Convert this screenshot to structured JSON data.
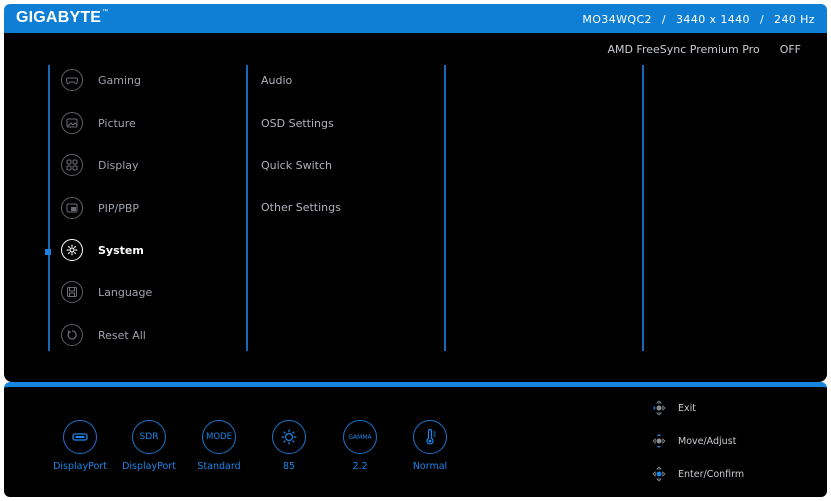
{
  "header": {
    "brand": "GIGABYTE",
    "trademark": "™",
    "model": "MO34WQC2",
    "separator": "/",
    "resolution": "3440 x 1440",
    "refresh_rate": "240 Hz"
  },
  "status": {
    "label": "AMD FreeSync Premium Pro",
    "value": "OFF"
  },
  "menu": {
    "items": [
      {
        "label": "Gaming",
        "icon": "gamepad-icon"
      },
      {
        "label": "Picture",
        "icon": "picture-icon"
      },
      {
        "label": "Display",
        "icon": "display-icon"
      },
      {
        "label": "PIP/PBP",
        "icon": "pip-icon"
      },
      {
        "label": "System",
        "icon": "gear-icon",
        "active": true
      },
      {
        "label": "Language",
        "icon": "language-icon"
      },
      {
        "label": "Reset All",
        "icon": "reset-icon"
      }
    ]
  },
  "submenu": {
    "items": [
      "Audio",
      "OSD Settings",
      "Quick Switch",
      "Other Settings"
    ]
  },
  "bottom": {
    "indicators": [
      {
        "icon": "input-port-icon",
        "text": "",
        "label": "DisplayPort"
      },
      {
        "icon": "sdr-icon",
        "text": "SDR",
        "label": "DisplayPort"
      },
      {
        "icon": "mode-icon",
        "text": "MODE",
        "label": "Standard"
      },
      {
        "icon": "brightness-icon",
        "text": "",
        "label": "85"
      },
      {
        "icon": "gamma-icon",
        "text": "GAMMA",
        "label": "2.2"
      },
      {
        "icon": "color-temp-icon",
        "text": "",
        "label": "Normal"
      }
    ],
    "hints": [
      {
        "label": "Exit",
        "icon": "joystick-left-icon"
      },
      {
        "label": "Move/Adjust",
        "icon": "joystick-updown-icon"
      },
      {
        "label": "Enter/Confirm",
        "icon": "joystick-press-icon"
      }
    ]
  },
  "colors": {
    "accent": "#0f7fd6",
    "active_marker": "#1a82e0",
    "background": "#000000"
  }
}
